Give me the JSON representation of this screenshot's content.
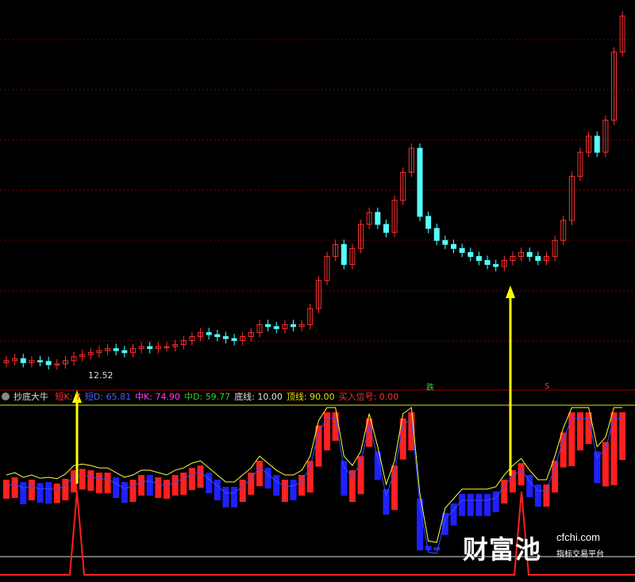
{
  "indicator": {
    "name": "抄底大牛",
    "items": [
      {
        "label": "短K: 7",
        "color": "#ff3030"
      },
      {
        "label": "短D: 65.81",
        "color": "#4060ff"
      },
      {
        "label": "中K: 74.90",
        "color": "#ff40ff"
      },
      {
        "label": "中D: 59.77",
        "color": "#30d030"
      },
      {
        "label": "底线: 10.00",
        "color": "#e0e0e0"
      },
      {
        "label": "顶线: 90.00",
        "color": "#e0e000"
      },
      {
        "label": "买入信号: 0.00",
        "color": "#ff3030"
      }
    ],
    "badge_green": "跌",
    "badge_red": "S"
  },
  "price_label": "12.52",
  "watermark": {
    "brand": "财富池",
    "url": "cfchi.com",
    "subtitle": "指标交易平台"
  },
  "colors": {
    "up": "#ff3030",
    "down": "#54ffff",
    "grid": "#800000",
    "arrow": "#ffff00",
    "hist_up": "#ff2020",
    "hist_down": "#2020ff"
  },
  "chart_data": {
    "type": "candlestick",
    "series_price": [
      12.6,
      12.65,
      12.55,
      12.6,
      12.58,
      12.5,
      12.52,
      12.6,
      12.7,
      12.75,
      12.8,
      12.85,
      12.9,
      12.85,
      12.8,
      12.9,
      12.95,
      12.9,
      12.95,
      12.95,
      13.0,
      13.1,
      13.2,
      13.3,
      13.25,
      13.2,
      13.15,
      13.1,
      13.2,
      13.3,
      13.5,
      13.45,
      13.4,
      13.5,
      13.45,
      13.5,
      13.9,
      14.6,
      15.2,
      15.5,
      15.0,
      15.4,
      16.0,
      16.3,
      16.0,
      15.8,
      16.6,
      17.3,
      17.9,
      16.2,
      15.9,
      15.6,
      15.5,
      15.4,
      15.3,
      15.2,
      15.1,
      15.0,
      14.95,
      15.1,
      15.2,
      15.3,
      15.2,
      15.1,
      15.2,
      15.6,
      16.1,
      17.2,
      17.8,
      18.2,
      17.8,
      18.6,
      20.3,
      21.2
    ]
  }
}
